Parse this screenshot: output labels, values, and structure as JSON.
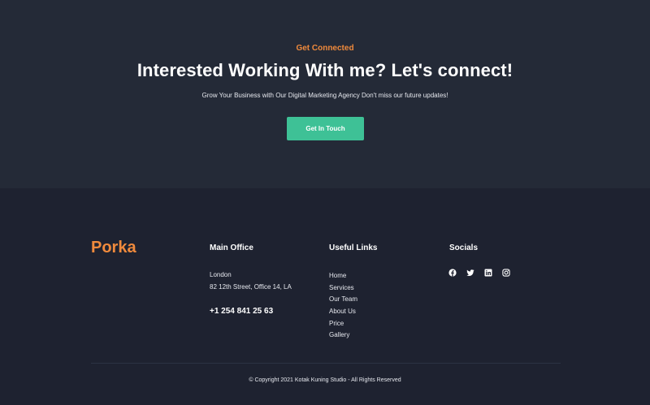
{
  "cta": {
    "eyebrow": "Get Connected",
    "headline": "Interested Working With me? Let's connect!",
    "subtitle": "Grow Your Business with Our Digital Marketing Agency Don't miss our future updates!",
    "button_label": "Get In Touch",
    "accent_color": "#f08a3c",
    "button_color": "#3ec196"
  },
  "footer": {
    "brand": "Porka",
    "main_office": {
      "title": "Main Office",
      "city": "London",
      "address": "82 12th Street, Office 14, LA",
      "phone": "+1 254 841 25 63"
    },
    "useful_links": {
      "title": "Useful Links",
      "items": [
        "Home",
        "Services",
        "Our Team",
        "About Us",
        "Price",
        "Gallery"
      ]
    },
    "socials": {
      "title": "Socials",
      "icons": [
        "facebook-icon",
        "twitter-icon",
        "linkedin-icon",
        "instagram-icon"
      ]
    },
    "copyright": "© Copyright 2021 Kotak Kuning Studio - All Rights Reserved"
  }
}
